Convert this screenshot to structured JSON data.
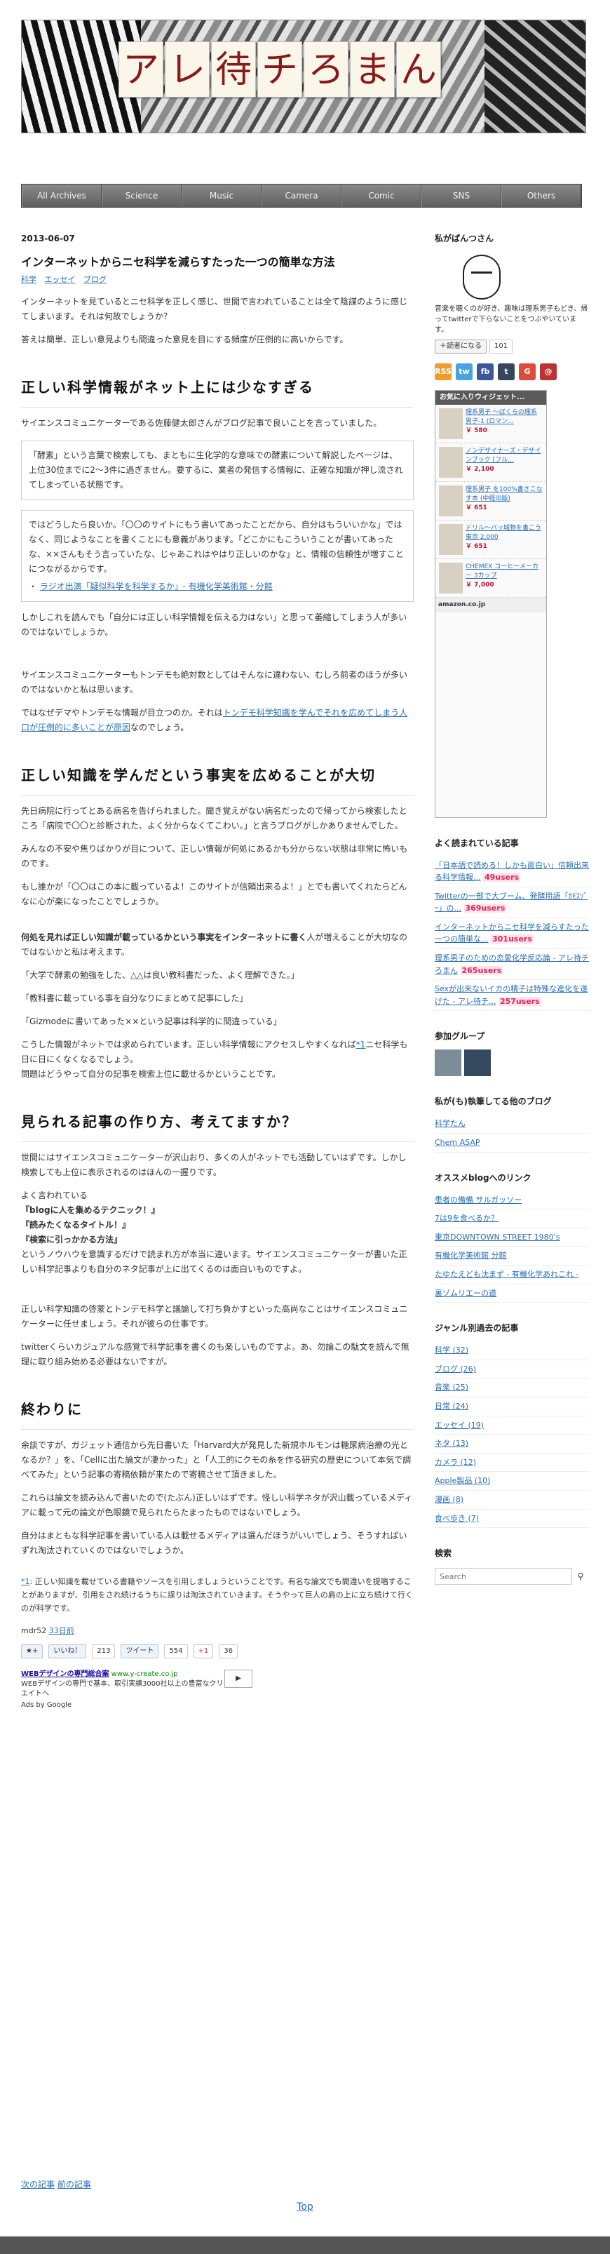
{
  "header": {
    "title_chars": [
      "ア",
      "レ",
      "待",
      "チ",
      "ろ",
      "ま",
      "ん"
    ]
  },
  "nav": [
    "All Archives",
    "Science",
    "Music",
    "Camera",
    "Comic",
    "SNS",
    "Others"
  ],
  "post": {
    "date": "2013-06-07",
    "title": "インターネットからニセ科学を減らすたった一つの簡単な方法",
    "categories": [
      "科学",
      "エッセイ",
      "ブログ"
    ],
    "intro": [
      "インターネットを見ているとニセ科学を正しく感じ、世間で言われていることは全て陰謀のように感じてしまいます。それは何故でしょうか？",
      "答えは簡単、正しい意見よりも間違った意見を目にする頻度が圧倒的に高いからです。"
    ],
    "s1": {
      "heading": "正しい科学情報がネット上には少なすぎる",
      "p1": "サイエンスコミュニケーターである佐藤健太郎さんがブログ記事で良いことを言っていました。",
      "quote1": "「酵素」という言葉で検索しても、まともに生化学的な意味での酵素について解説したページは、上位30位までに2～3件に過ぎません。要するに、業者の発信する情報に、正確な知識が押し流されてしまっている状態です。",
      "quote2": "ではどうしたら良いか。「〇〇のサイトにもう書いてあったことだから、自分はもういいかな」ではなく、同じようなことを書くことにも意義があります。「どこかにもこういうことが書いてあったな、××さんもそう言っていたな、じゃあこれはやはり正しいのかな」と、情報の信頼性が増すことにつながるからです。",
      "quote_link": "ラジオ出演「疑似科学を科学するか」- 有機化学美術館・分館",
      "p2": "しかしこれを読んでも「自分には正しい科学情報を伝える力はない」と思って萎縮してしまう人が多いのではないでしょうか。",
      "p3": "サイエンスコミュニケーターもトンデモも絶対数としてはそんなに違わない、むしろ前者のほうが多いのではないかと私は思います。",
      "p4_pre": "ではなぜデマやトンデモな情報が目立つのか。それは",
      "p4_link": "トンデモ科学知識を学んでそれを広めてしまう人口が圧倒的に多いことが原因",
      "p4_post": "なのでしょう。"
    },
    "s2": {
      "heading": "正しい知識を学んだという事実を広めることが大切",
      "p1": "先日病院に行ってとある病名を告げられました。聞き覚えがない病名だったので帰ってから検索したところ「病院で〇〇と診断された、よく分からなくてこわい。」と言うブログがしかありませんでした。",
      "p2": "みんなの不安や焦りばかりが目について、正しい情報が何処にあるかも分からない状態は非常に怖いものです。",
      "p3": "もし誰かが「〇〇はこの本に載っているよ！このサイトが信頼出来るよ！」とでも書いてくれたらどんなに心が楽になったことでしょうか。",
      "p4_bold": "何処を見れば正しい知識が載っているかという事実をインターネットに書く",
      "p4_rest": "人が増えることが大切なのではないかと私は考えます。",
      "ex1": "「大学で酵素の勉強をした、△△は良い教科書だった、よく理解できた。」",
      "ex2": "「教科書に載っている事を自分なりにまとめて記事にした」",
      "ex3": "「Gizmodeに書いてあった××という記事は科学的に間違っている」",
      "p5_pre": "こうした情報がネットでは求められています。正しい科学情報にアクセスしやすくなれば",
      "p5_link": "*1",
      "p5_post": "ニセ科学も日に日にくなくなるでしょう。",
      "p6": "問題はどうやって自分の記事を検索上位に載せるかということです。"
    },
    "s3": {
      "heading": "見られる記事の作り方、考えてますか？",
      "p1": "世間にはサイエンスコミュニケーターが沢山おり、多くの人がネットでも活動していはずです。しかし検索しても上位に表示されるのはほんの一握りです。",
      "p2": "よく言われている",
      "b1": "『blogに人を集めるテクニック！』",
      "b2": "『読みたくなるタイトル！』",
      "b3": "『検索に引っかかる方法』",
      "p3": "というノウハウを意識するだけで読まれ方が本当に違います。サイエンスコミュニケーターが書いた正しい科学記事よりも自分のネタ記事が上に出てくるのは面白いものですよ。",
      "p4": "正しい科学知識の啓蒙とトンデモ科学と議論して打ち負かすといった高尚なことはサイエンスコミュニケーターに任せましょう。それが彼らの仕事です。",
      "p5": "twitterくらいカジュアルな感覚で科学記事を書くのも楽しいものですよ。あ、勿論この駄文を読んで無理に取り組み始める必要はないですが。"
    },
    "s4": {
      "heading": "終わりに",
      "p1": "余談ですが、ガジェット通信から先日書いた「Harvard大が発見した新規ホルモンは糖尿病治療の光となるか？」を、「Cellに出た論文が凄かった」と「人工的にクモの糸を作る研究の歴史について本気で調べてみた」という記事の寄稿依頼が来たので寄稿させて頂きました。",
      "p2": "これらは論文を読み込んで書いたので(たぶん)正しいはずです。怪しい科学ネタが沢山載っているメディアに載って元の論文が色眼鏡で見られたらたまったものではないでしょう。",
      "p3": "自分はまともな科学記事を書いている人は載せるメディアは選んだほうがいいでしょう、そうすればいずれ淘汰されていくのではないでしょうか。"
    },
    "footnote_mark": "*1",
    "footnote": ": 正しい知識を載せている書籍やソースを引用しましょうということです。有名な論文でも間違いを提唱することがありますが、引用をされ続けるうちに誤りは淘汰されていきます。そうやって巨人の肩の上に立ち続けて行くのが科学です。",
    "author": "mdr52",
    "time": "33日前",
    "share": {
      "like": "いいね！",
      "like_count": "213",
      "tweet": "ツイート",
      "tweet_count": "554",
      "plus": "+1",
      "plus_count": "36"
    },
    "ad": {
      "title": "WEBデザインの専門総合案",
      "url": "www.y-create.co.jp",
      "desc": "WEBデザインの専門で基本、取引実績3000社以上の豊富なクリエイトへ",
      "ads_by": "Ads by Google"
    }
  },
  "sidebar": {
    "profile_title": "私がぱんつさん",
    "profile_text": "音楽を聴くのが好き、趣味は理系男子もどき、帰ってtwitterで下らないことをつぶやいています。",
    "follow_label": "読者になる",
    "follow_count": "101",
    "icons": [
      "RSS",
      "tw",
      "fb",
      "t",
      "G",
      "@"
    ],
    "amazon": {
      "header": "お気に入りウィジェット...",
      "items": [
        {
          "t": "理系男子 〜ぼくらの理系男子-1 (ロマン...",
          "price": "￥ 580"
        },
        {
          "t": "ノンデザイナーズ・デザインブック [フル...",
          "price": "￥ 2,100"
        },
        {
          "t": "理系男子 を100%書きこなす本 (中経出版)",
          "price": "￥ 651"
        },
        {
          "t": "ドリル〜バッ城物を書こう 東京 2,000",
          "price": "￥ 651"
        },
        {
          "t": "CHEMEX コーヒーメーカー 3カップ",
          "price": "￥ 7,000"
        }
      ],
      "footer": "amazon.co.jp"
    },
    "popular_title": "よく読まれている記事",
    "popular": [
      {
        "t": "「日本語で読める！しかも面白い」信頼出来る科学情報...",
        "u": "49users"
      },
      {
        "t": "Twitterの一部で大ブーム、発酵用語「ｶﾓｽｿﾞｰ」の...",
        "u": "369users"
      },
      {
        "t": "インターネットからニセ科学を減らすたった一つの簡単な...",
        "u": "301users"
      },
      {
        "t": "理系男子のための恋愛化学反応論 - アレ待チろまん",
        "u": "265users"
      },
      {
        "t": "Sexが出来ないイカの精子は特殊な進化を遂げた - アレ待チ...",
        "u": "257users"
      }
    ],
    "group_title": "参加グループ",
    "related_title": "私が(も)執筆してる他のブログ",
    "related": [
      "科学たん",
      "Chem ASAP"
    ],
    "links_title": "オススメblogへのリンク",
    "links": [
      "患者の備備 サルガッソー",
      "7は9を食べるか？",
      "東京DOWNTOWN STREET 1980's",
      "有機化学美術館 分館",
      "たゆたえども沈まず - 有機化学あれこれ -",
      "裏ゾムリエーの道"
    ],
    "cats_title": "ジャンル別過去の記事",
    "cats": [
      "科学 (32)",
      "ブログ (26)",
      "音楽 (25)",
      "日常 (24)",
      "エッセイ (19)",
      "ネタ (13)",
      "カメラ (12)",
      "Apple製品 (10)",
      "漫画 (8)",
      "食べ歩き (7)"
    ],
    "search_title": "検索",
    "search_placeholder": "Search"
  },
  "footer": {
    "prev": "次の記事",
    "next": "前の記事",
    "top": "Top"
  }
}
